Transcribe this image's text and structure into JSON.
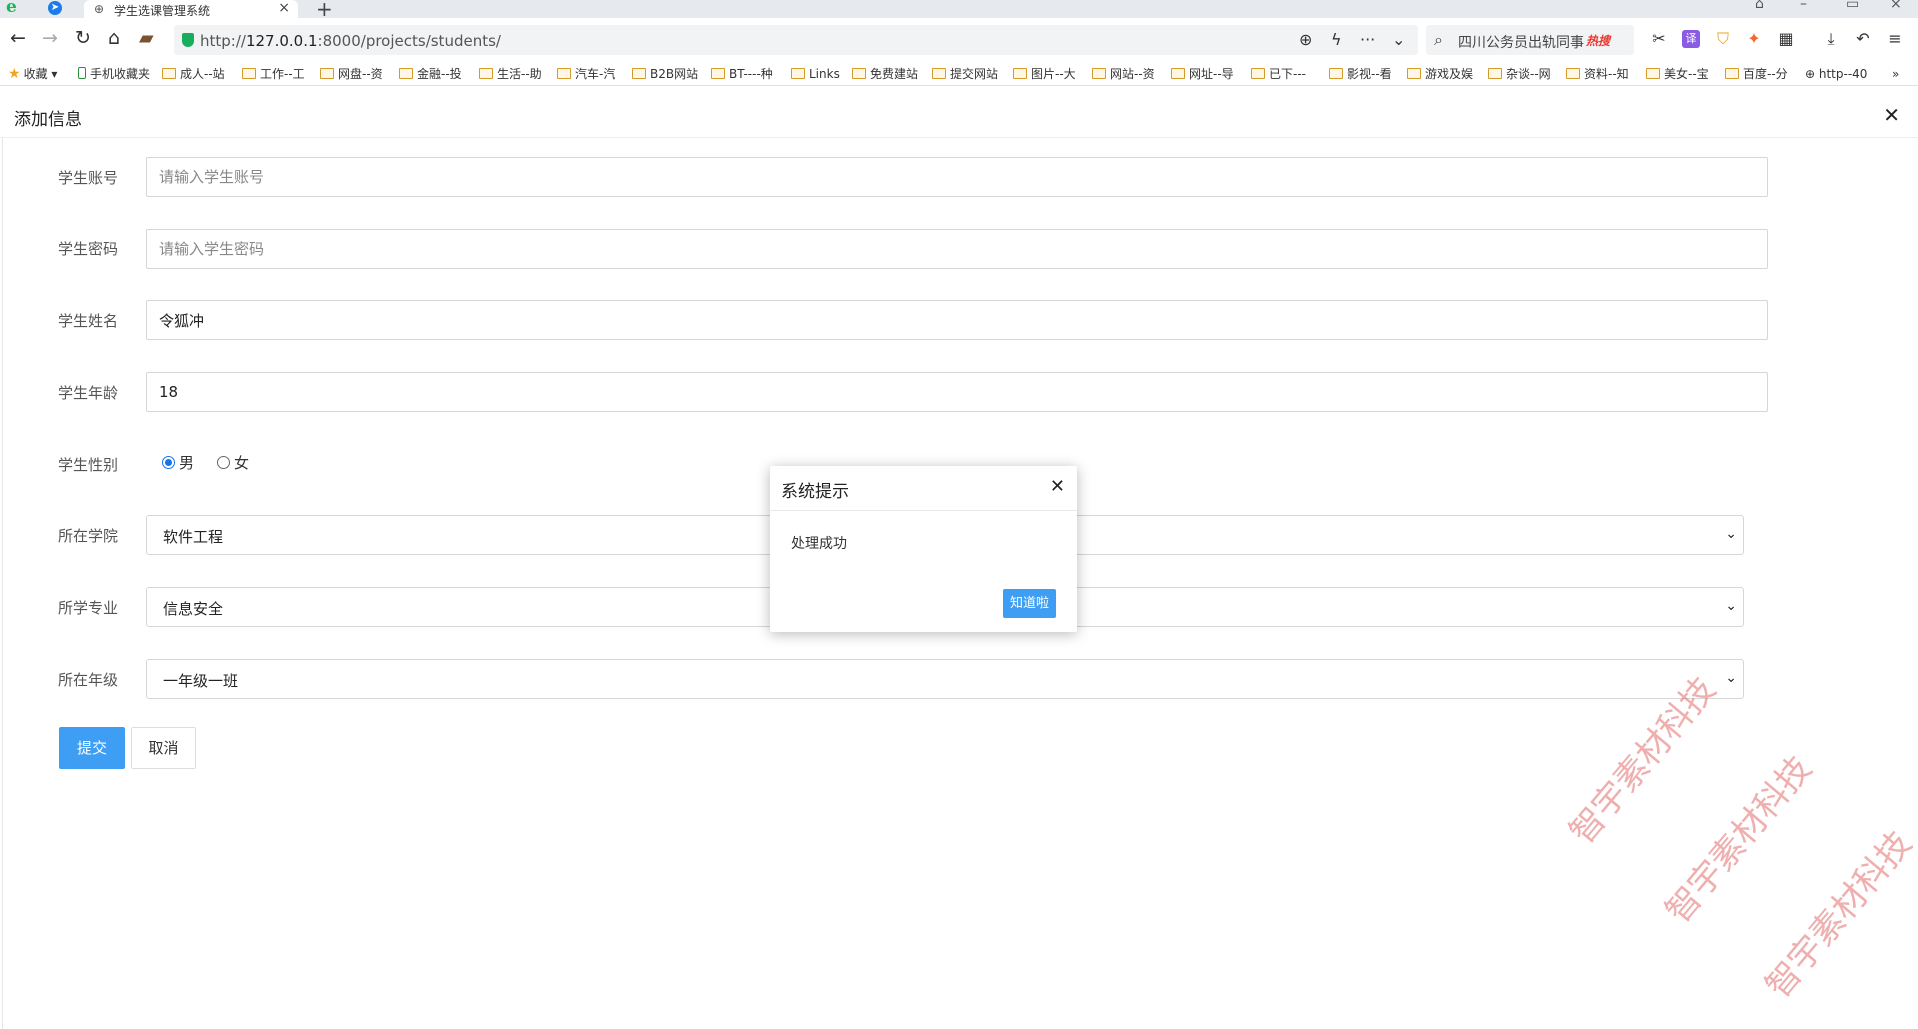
{
  "browser": {
    "tab_title": "学生选课管理系统",
    "url_prefix": "http://",
    "url_host": "127.0.0.1",
    "url_rest": ":8000/projects/students/",
    "search_text": "四川公务员出轨同事",
    "search_badge": "热搜",
    "bookmarks": [
      "收藏",
      "手机收藏夹",
      "成人--站",
      "工作--工",
      "网盘--资",
      "金融--投",
      "生活--助",
      "汽车-汽",
      "B2B网站",
      "BT----种",
      "Links",
      "免费建站",
      "提交网站",
      "图片--大",
      "网站--资",
      "网址--导",
      "已下---",
      "影视--看",
      "游戏及娱",
      "杂谈--网",
      "资料--知",
      "美女--宝",
      "百度--分",
      "http--40"
    ]
  },
  "page": {
    "title": "添加信息",
    "form": {
      "account_label": "学生账号",
      "account_placeholder": "请输入学生账号",
      "password_label": "学生密码",
      "password_placeholder": "请输入学生密码",
      "name_label": "学生姓名",
      "name_value": "令狐冲",
      "age_label": "学生年龄",
      "age_value": "18",
      "gender_label": "学生性别",
      "gender_options": [
        "男",
        "女"
      ],
      "gender_selected": "男",
      "college_label": "所在学院",
      "college_value": "软件工程",
      "major_label": "所学专业",
      "major_value": "信息安全",
      "grade_label": "所在年级",
      "grade_value": "一年级一班",
      "submit_label": "提交",
      "cancel_label": "取消"
    }
  },
  "modal": {
    "title": "系统提示",
    "message": "处理成功",
    "ok_label": "知道啦"
  },
  "watermark": "智宇素材科技",
  "colors": {
    "primary": "#3e9ef4",
    "radio_checked": "#1a73e8",
    "watermark": "#e26e6e"
  }
}
